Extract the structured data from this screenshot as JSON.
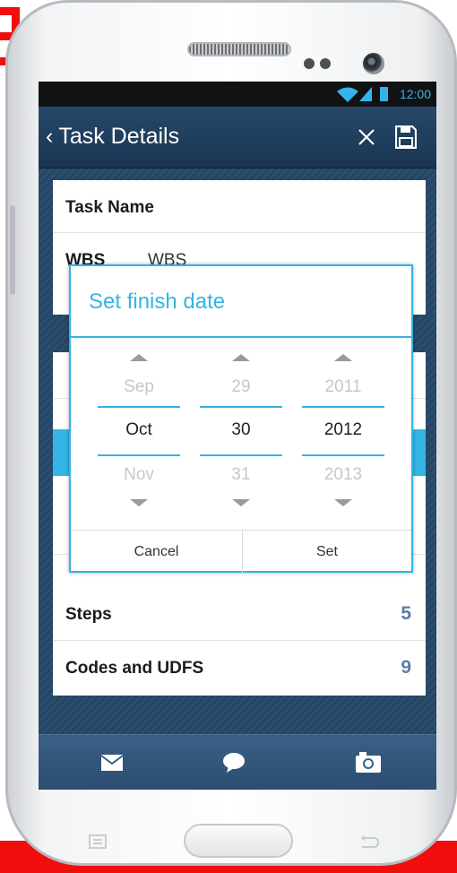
{
  "status": {
    "time": "12:00"
  },
  "actionbar": {
    "title": "Task Details",
    "back_glyph": "‹",
    "close_icon": "close-icon",
    "save_icon": "save-icon"
  },
  "details": {
    "task_name_label": "Task Name",
    "wbs_label": "WBS",
    "wbs_value": "WBS",
    "steps_label": "Steps",
    "steps_count": "5",
    "codes_label": "Codes and UDFS",
    "codes_count": "9"
  },
  "dialog": {
    "title": "Set finish date",
    "month": {
      "prev": "Sep",
      "current": "Oct",
      "next": "Nov"
    },
    "day": {
      "prev": "29",
      "current": "30",
      "next": "31"
    },
    "year": {
      "prev": "2011",
      "current": "2012",
      "next": "2013"
    },
    "cancel_label": "Cancel",
    "set_label": "Set"
  },
  "bottombar": {
    "icons": [
      "mail-icon",
      "chat-icon",
      "camera-icon"
    ]
  },
  "colors": {
    "accent": "#33b5e5",
    "actionbar": "#1f3d5e",
    "count": "#5a7ea3",
    "red": "#f20d0d"
  }
}
